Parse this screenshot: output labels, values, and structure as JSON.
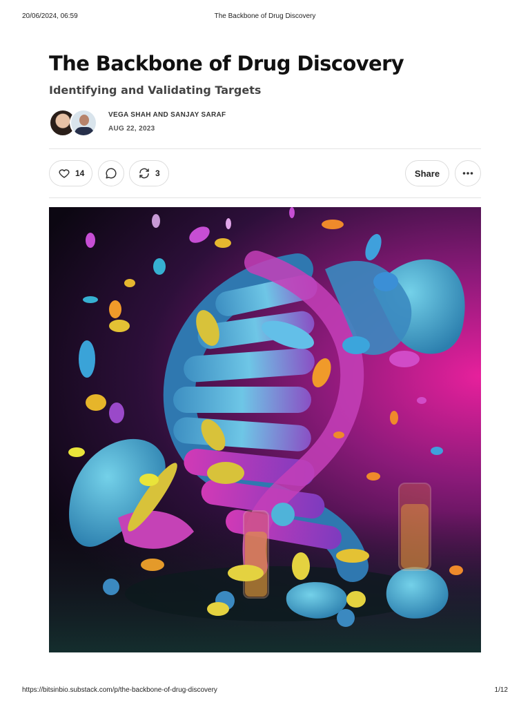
{
  "print_header": {
    "datetime": "20/06/2024, 06:59",
    "document_title": "The Backbone of Drug Discovery"
  },
  "article": {
    "title": "The Backbone of Drug Discovery",
    "subtitle": "Identifying and Validating Targets",
    "authors": "VEGA SHAH AND SANJAY SARAF",
    "published_date": "AUG 22, 2023"
  },
  "actions": {
    "like_icon": "heart-icon",
    "like_count": "14",
    "comment_icon": "comment-bubble-icon",
    "restack_icon": "restack-arrows-icon",
    "restack_count": "3",
    "share_label": "Share",
    "more_icon": "ellipsis-icon"
  },
  "hero_image": {
    "description_icon": "illustration",
    "colors": {
      "background_dark": "#0c0712",
      "background_magenta": "#e7209c",
      "helix_blue": "#4fb3d9",
      "helix_pink": "#c43fb9"
    }
  },
  "print_footer": {
    "url": "https://bitsinbio.substack.com/p/the-backbone-of-drug-discovery",
    "page_indicator": "1/12"
  }
}
